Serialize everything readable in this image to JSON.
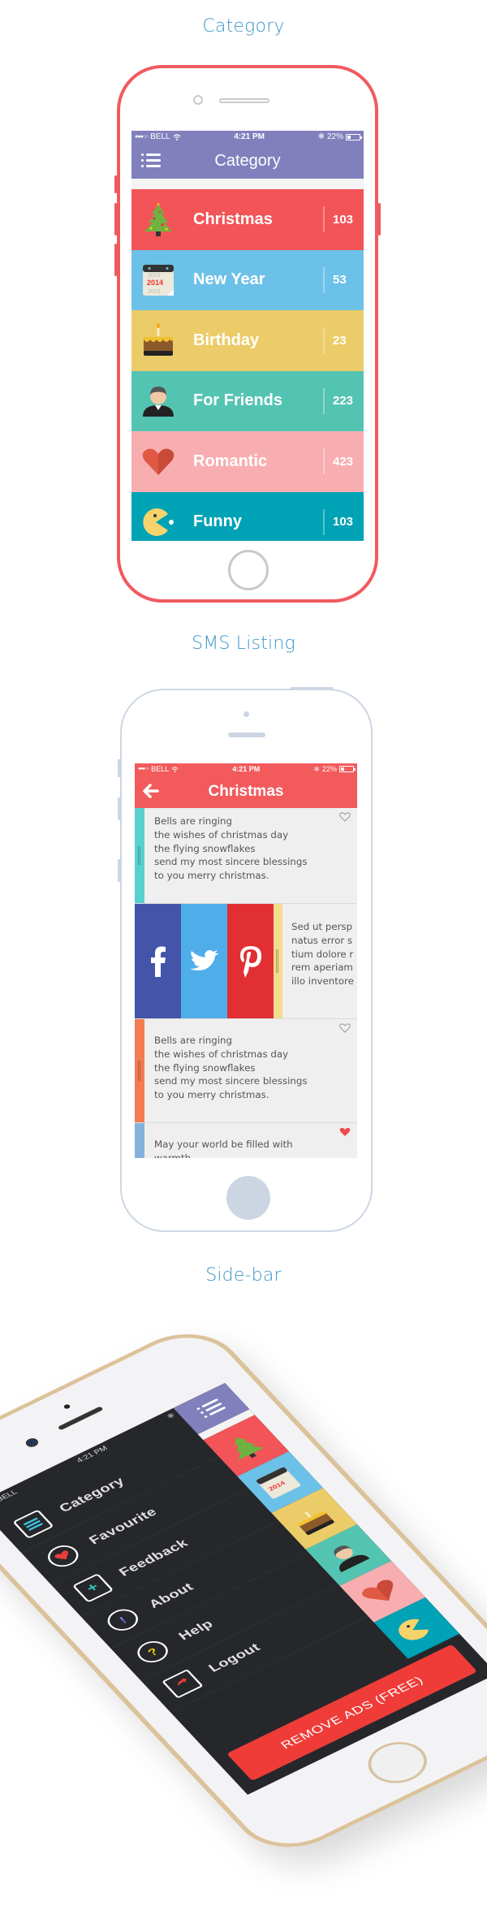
{
  "sections": {
    "category_title": "Category",
    "sms_title": "SMS Listing",
    "sidebar_title": "Side-bar"
  },
  "status_bar": {
    "carrier": "BELL",
    "signal": "●●●○○",
    "time": "4:21 PM",
    "battery": "22%"
  },
  "colors": {
    "section_title": "#3d97c9",
    "category_nav": "#8180bd",
    "sms_nav": "#f25a5c",
    "sidebar_bg": "#25272b",
    "remove_ads": "#ef3c38"
  },
  "category_screen": {
    "title": "Category",
    "menu_icon": "hamburger-menu-icon",
    "items": [
      {
        "name": "Christmas",
        "count": "103",
        "color": "#f25457",
        "icon": "christmas-tree-icon"
      },
      {
        "name": "New Year",
        "count": "53",
        "color": "#6cc1e8",
        "icon": "calendar-icon"
      },
      {
        "name": "Birthday",
        "count": "23",
        "color": "#ebcc68",
        "icon": "birthday-cake-icon"
      },
      {
        "name": "For Friends",
        "count": "223",
        "color": "#54c4b2",
        "icon": "person-icon"
      },
      {
        "name": "Romantic",
        "count": "423",
        "color": "#f8aeb0",
        "icon": "heart-icon"
      },
      {
        "name": "Funny",
        "count": "103",
        "color": "#00a2b5",
        "icon": "pacman-icon"
      }
    ]
  },
  "sms_screen": {
    "title": "Christmas",
    "back_icon": "back-arrow-icon",
    "messages": [
      {
        "text": "Bells are ringing\nthe wishes of christmas day\nthe flying snowflakes\nsend my most sincere blessings\nto you merry christmas.",
        "strip_color": "#58d0d0",
        "favourite": false
      },
      {
        "text": "Bells are ringing\nthe wishes of christmas day\nthe flying snowflakes\nsend my most sincere blessings\nto you merry christmas.",
        "strip_color": "#f37b52",
        "favourite": false
      },
      {
        "text": "May your world be filled with\nwarmth",
        "strip_color": "#83b3dd",
        "favourite": true
      }
    ],
    "share_row": {
      "text": "Sed ut persp\nnatus error s\ntium dolore r\nrem aperiam\nillo inventore",
      "buttons": [
        {
          "name": "facebook",
          "glyph": "f",
          "color": "#4454a8"
        },
        {
          "name": "twitter",
          "glyph": "twitter-bird",
          "color": "#4fadea"
        },
        {
          "name": "pinterest",
          "glyph": "p",
          "color": "#e22f33"
        }
      ]
    }
  },
  "sidebar_screen": {
    "menu": [
      {
        "label": "Category",
        "icon": "list-icon",
        "accent": "#3fc6e6"
      },
      {
        "label": "Favourite",
        "icon": "heart-icon",
        "accent": "#ea3c3c"
      },
      {
        "label": "Feedback",
        "icon": "chat-plus-icon",
        "accent": "#2fc3b5"
      },
      {
        "label": "About",
        "icon": "info-icon",
        "accent": "#8a7ff0"
      },
      {
        "label": "Help",
        "icon": "question-icon",
        "accent": "#f2d300"
      },
      {
        "label": "Logout",
        "icon": "logout-icon",
        "accent": "#ef3c38"
      }
    ],
    "remove_ads_label": "REMOVE ADS (FREE)"
  }
}
